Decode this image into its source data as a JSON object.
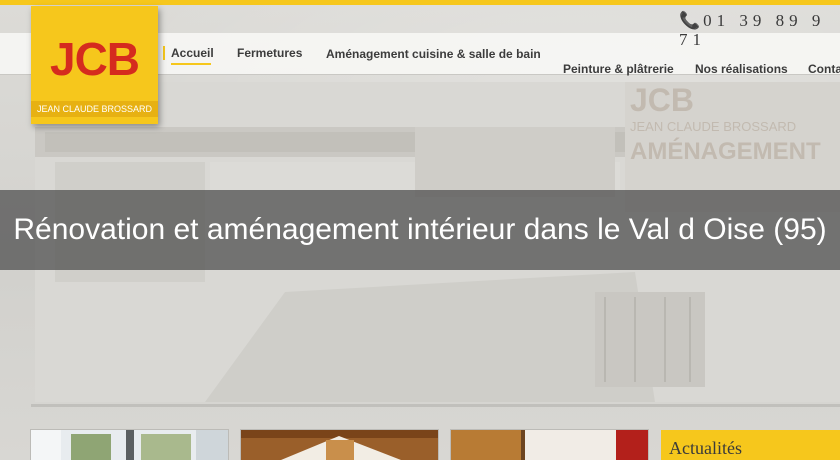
{
  "brand": {
    "logo_text": "JCB",
    "logo_subtitle": "JEAN CLAUDE BROSSARD",
    "colors": {
      "accent": "#f6c71c",
      "logo_red": "#d52b1e"
    }
  },
  "header": {
    "phone_icon": "phone-icon",
    "phone_number": "01 39 89 9 71"
  },
  "nav": {
    "items": [
      {
        "label": "Accueil",
        "active": true
      },
      {
        "label": "Fermetures"
      },
      {
        "label": "Aménagement cuisine & salle de bain"
      },
      {
        "label": "Peinture & plâtrerie"
      },
      {
        "label": "Nos réalisations"
      },
      {
        "label": "Conta"
      }
    ]
  },
  "hero": {
    "background_sign": {
      "line1": "JCB",
      "line2": "JEAN CLAUDE BROSSARD",
      "line3": "AMÉNAGEMENT"
    },
    "banner_title": "Rénovation et aménagement intérieur dans le Val d Oise (95)"
  },
  "sidebar": {
    "news_title": "Actualités"
  }
}
